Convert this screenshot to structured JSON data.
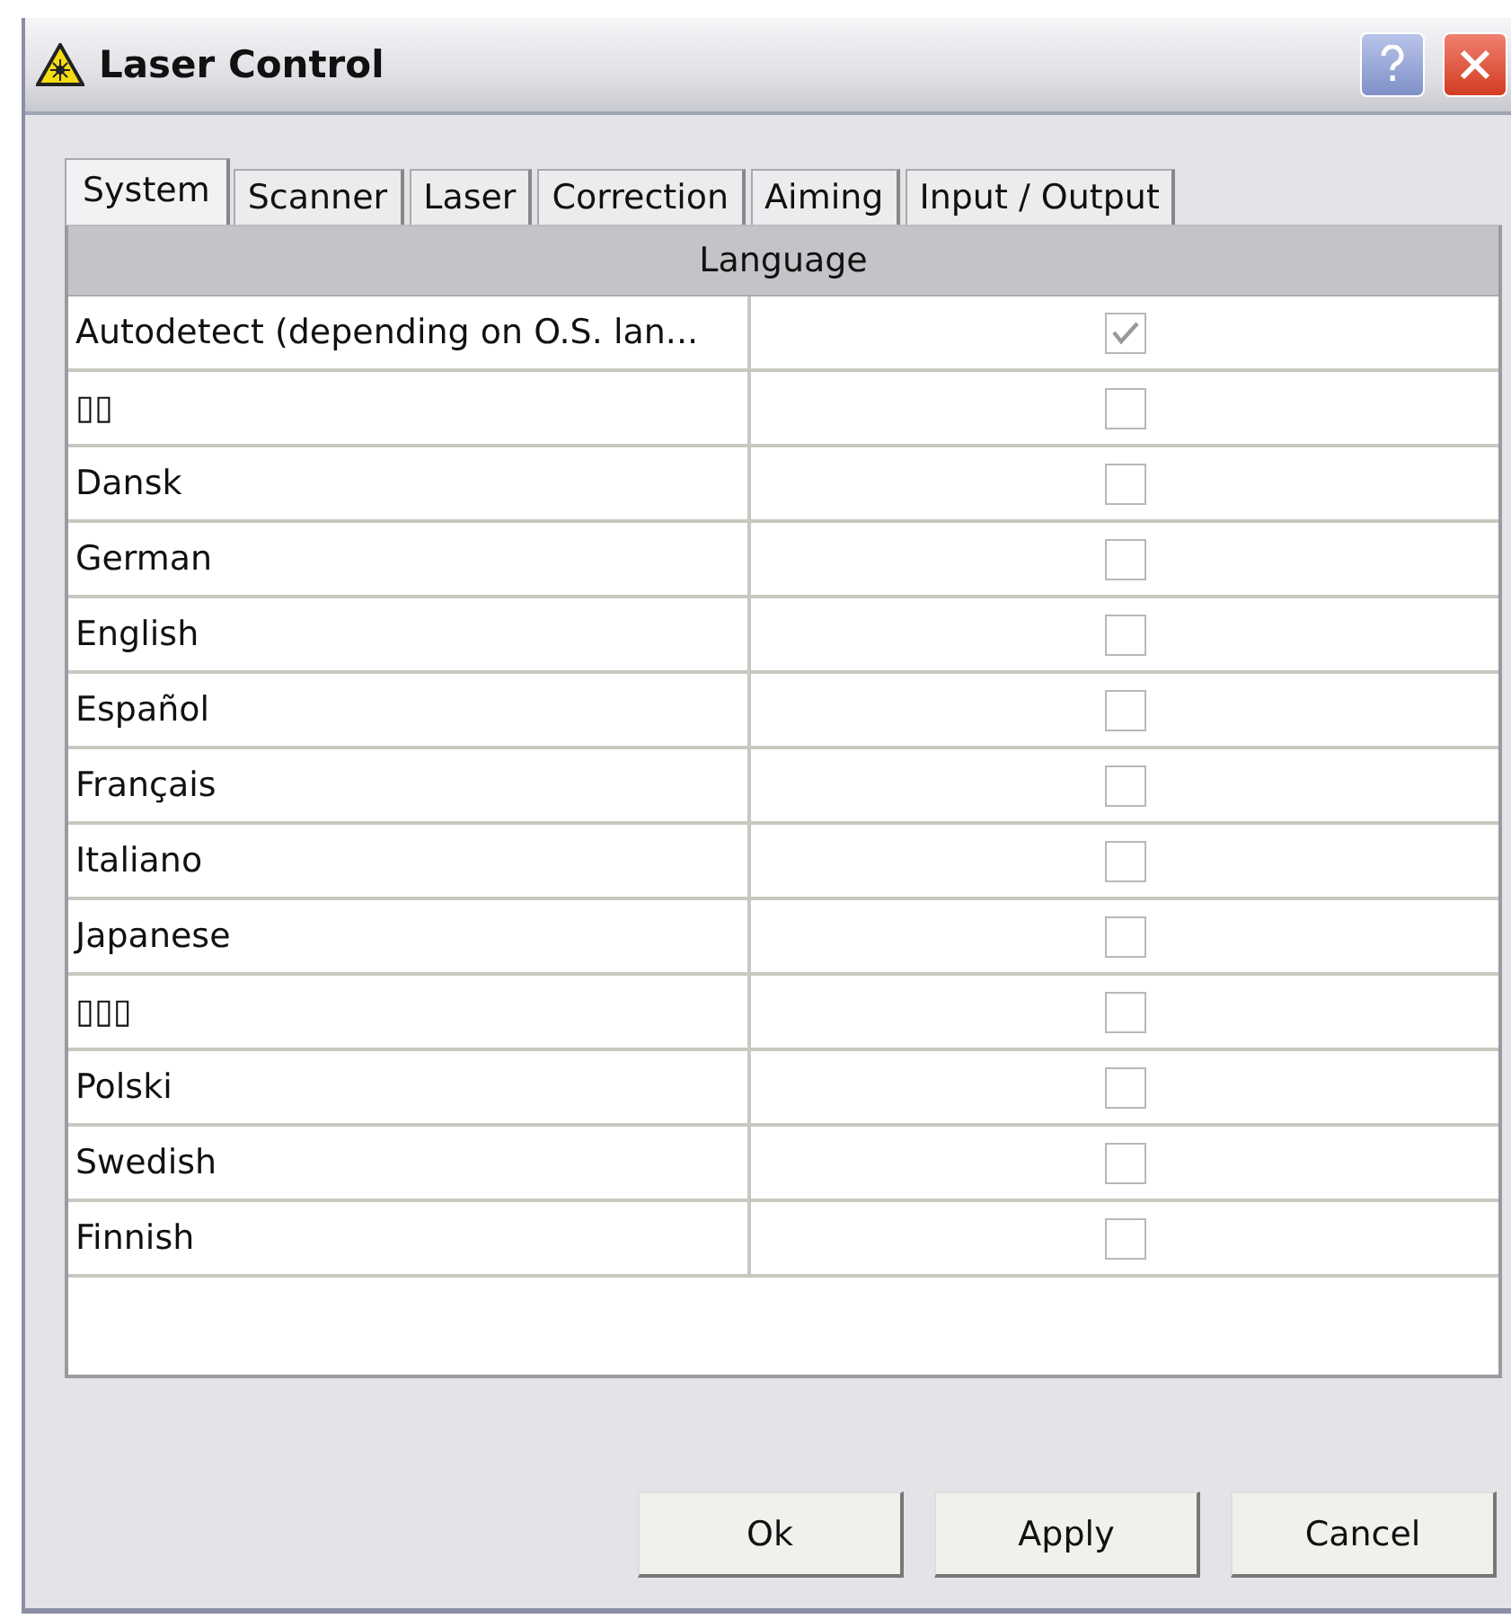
{
  "window": {
    "title": "Laser Control"
  },
  "tabs": [
    {
      "label": "System",
      "selected": true
    },
    {
      "label": "Scanner",
      "selected": false
    },
    {
      "label": "Laser",
      "selected": false
    },
    {
      "label": "Correction",
      "selected": false
    },
    {
      "label": "Aiming",
      "selected": false
    },
    {
      "label": "Input / Output",
      "selected": false
    }
  ],
  "table": {
    "header": "Language",
    "rows": [
      {
        "name": "Autodetect (depending on O.S. lan...",
        "checked": true
      },
      {
        "name": "▯▯",
        "checked": false
      },
      {
        "name": "Dansk",
        "checked": false
      },
      {
        "name": "German",
        "checked": false
      },
      {
        "name": "English",
        "checked": false
      },
      {
        "name": "Español",
        "checked": false
      },
      {
        "name": "Français",
        "checked": false
      },
      {
        "name": "Italiano",
        "checked": false
      },
      {
        "name": "Japanese",
        "checked": false
      },
      {
        "name": "▯▯▯",
        "checked": false
      },
      {
        "name": "Polski",
        "checked": false
      },
      {
        "name": "Swedish",
        "checked": false
      },
      {
        "name": "Finnish",
        "checked": false
      }
    ]
  },
  "buttons": [
    "Ok",
    "Apply",
    "Cancel"
  ]
}
